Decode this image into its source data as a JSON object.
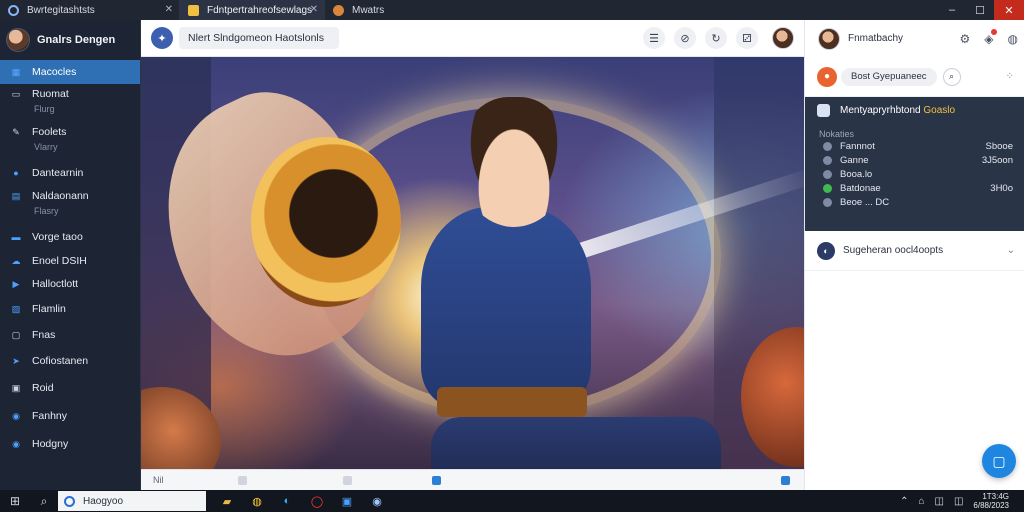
{
  "browser": {
    "tabs": [
      {
        "label": "Bwrtegitashtsts",
        "icon_color": "#8ab4f8",
        "active": false
      },
      {
        "label": "Fdntpertrahreofsewlags",
        "icon_color": "#f0c040",
        "active": true
      },
      {
        "label": "Mwatrs",
        "icon_color": "#d9853b",
        "active": false
      }
    ],
    "window_controls": {
      "minimize": "–",
      "maximize": "☐",
      "close": "✕"
    },
    "tab_close": "✕"
  },
  "sidebar": {
    "brand": "Gnalrs Dengen",
    "items": [
      {
        "label": "Macocles",
        "icon": "dashboard-icon",
        "glyph": "▦",
        "icon_color": "#5aa9ff",
        "active": true,
        "sub": ""
      },
      {
        "label": "Ruomat",
        "icon": "monitor-icon",
        "glyph": "▭",
        "icon_color": "#cfd6e2",
        "active": false,
        "sub": "Flurg"
      },
      {
        "label": "Foolets",
        "icon": "pencil-icon",
        "glyph": "✎",
        "icon_color": "#cfd6e2",
        "active": false,
        "sub": "Vlarry"
      },
      {
        "label": "Dantearnin",
        "icon": "users-icon",
        "glyph": "●",
        "icon_color": "#4aa3ff",
        "active": false,
        "sub": ""
      },
      {
        "label": "Naldaonann",
        "icon": "calendar-icon",
        "glyph": "▤",
        "icon_color": "#4aa3ff",
        "active": false,
        "sub": "Flasry"
      },
      {
        "label": "Vorge taoo",
        "icon": "folder-icon",
        "glyph": "▬",
        "icon_color": "#4aa3ff",
        "active": false,
        "sub": ""
      },
      {
        "label": "Enoel DSIH",
        "icon": "cloud-icon",
        "glyph": "☁",
        "icon_color": "#4aa3ff",
        "active": false,
        "sub": ""
      },
      {
        "label": "Halloctlott",
        "icon": "play-icon",
        "glyph": "▶",
        "icon_color": "#4aa3ff",
        "active": false,
        "sub": ""
      },
      {
        "label": "Flamlin",
        "icon": "chart-icon",
        "glyph": "▨",
        "icon_color": "#4aa3ff",
        "active": false,
        "sub": ""
      },
      {
        "label": "Fnas",
        "icon": "file-icon",
        "glyph": "▢",
        "icon_color": "#cfd6e2",
        "active": false,
        "sub": ""
      },
      {
        "label": "Cofiostanen",
        "icon": "send-icon",
        "glyph": "➤",
        "icon_color": "#4aa3ff",
        "active": false,
        "sub": ""
      },
      {
        "label": "Roid",
        "icon": "device-icon",
        "glyph": "▣",
        "icon_color": "#cfd6e2",
        "active": false,
        "sub": ""
      },
      {
        "label": "Fanhny",
        "icon": "globe-icon",
        "glyph": "◉",
        "icon_color": "#4aa3ff",
        "active": false,
        "sub": ""
      },
      {
        "label": "Hodgny",
        "icon": "globe2-icon",
        "glyph": "◉",
        "icon_color": "#4aa3ff",
        "active": false,
        "sub": ""
      }
    ]
  },
  "center": {
    "search_text": "Nlert Slndgomeon Haotslonls",
    "top_icons": [
      {
        "name": "layers-icon",
        "glyph": "☰"
      },
      {
        "name": "shield-icon",
        "glyph": "⊘"
      },
      {
        "name": "refresh-icon",
        "glyph": "↻"
      },
      {
        "name": "gift-icon",
        "glyph": "⚂"
      }
    ],
    "status_label": "Nil"
  },
  "rpanel": {
    "username": "Fnmatbachy",
    "head_icons": [
      {
        "name": "settings-icon",
        "glyph": "⚙"
      },
      {
        "name": "shield-icon",
        "glyph": "◈"
      },
      {
        "name": "user-icon",
        "glyph": "◍"
      }
    ],
    "filter_pill": "Bost Gyepuaneec",
    "card": {
      "title": "Mentyapryrhbtond Goaslo",
      "title_highlight": "Goaslo",
      "section": "Nokaties",
      "rows": [
        {
          "label": "Fannnot",
          "value": "Sbooe",
          "icon_color": "#7f8aa3"
        },
        {
          "label": "Ganne",
          "value": "3J5oon",
          "icon_color": "#7f8aa3"
        },
        {
          "label": "Booa.lo",
          "value": "",
          "icon_color": "#7f8aa3"
        },
        {
          "label": "Batdonae",
          "value": "3H0o",
          "icon_color": "#3fb950"
        },
        {
          "label": "Beoe ... DC",
          "value": "",
          "icon_color": "#7f8aa3"
        }
      ]
    },
    "section2_label": "Sugeheran oocl4oopts",
    "colors": {
      "accent": "#1e86e0",
      "active_nav": "#2f6fb3",
      "card_bg": "#2a3447",
      "highlight": "#f0c040"
    }
  },
  "taskbar": {
    "search_text": "Haogyoo",
    "apps": [
      {
        "name": "file-explorer-icon",
        "glyph": "▰",
        "color": "#e8b84a"
      },
      {
        "name": "chrome-icon",
        "glyph": "◍",
        "color": "#ffcc33"
      },
      {
        "name": "edge-icon",
        "glyph": "◐",
        "color": "#3fa9f5"
      },
      {
        "name": "opera-icon",
        "glyph": "◯",
        "color": "#ff3b3b"
      },
      {
        "name": "store-icon",
        "glyph": "▣",
        "color": "#4aa3ff"
      },
      {
        "name": "chat-icon",
        "glyph": "◉",
        "color": "#9ec9ff"
      }
    ],
    "tray": [
      "⌃",
      "⌂",
      "◫",
      "◫"
    ],
    "clock_time": "1T3:4G",
    "clock_date": "6/88/2023"
  }
}
